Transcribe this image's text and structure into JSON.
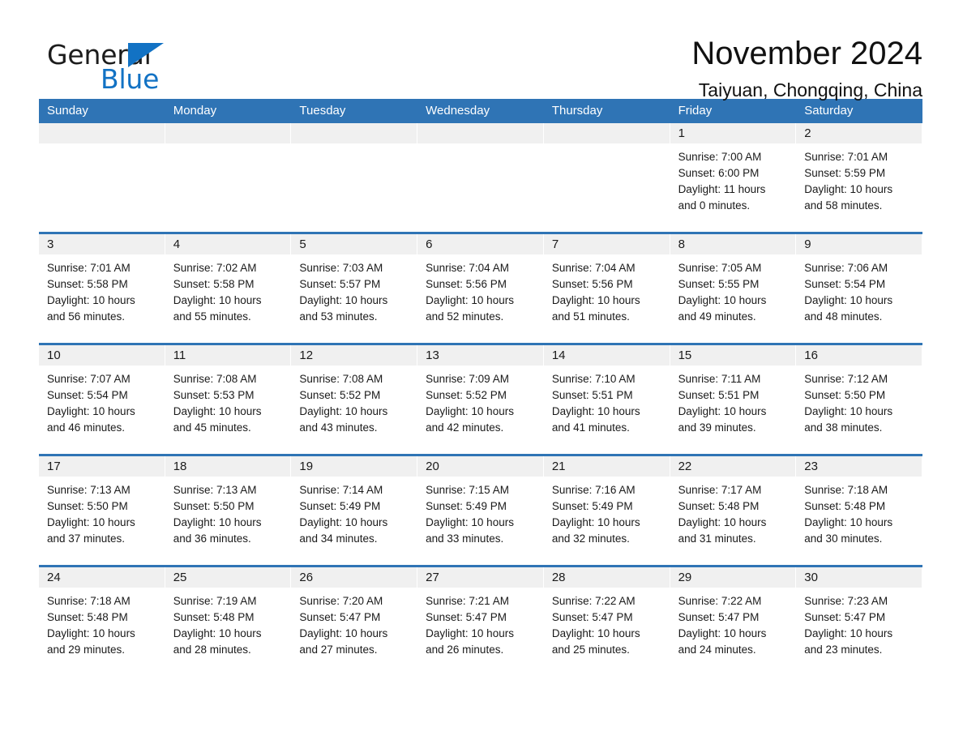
{
  "brand": {
    "word_general": "General",
    "word_blue": "Blue",
    "accent_color": "#1272c4"
  },
  "header": {
    "month_title": "November 2024",
    "location": "Taiyuan, Chongqing, China"
  },
  "calendar": {
    "header_color": "#2f74b5",
    "weekdays": [
      "Sunday",
      "Monday",
      "Tuesday",
      "Wednesday",
      "Thursday",
      "Friday",
      "Saturday"
    ],
    "weeks": [
      [
        {
          "day": "",
          "lines": []
        },
        {
          "day": "",
          "lines": []
        },
        {
          "day": "",
          "lines": []
        },
        {
          "day": "",
          "lines": []
        },
        {
          "day": "",
          "lines": []
        },
        {
          "day": "1",
          "lines": [
            "Sunrise: 7:00 AM",
            "Sunset: 6:00 PM",
            "Daylight: 11 hours",
            "and 0 minutes."
          ]
        },
        {
          "day": "2",
          "lines": [
            "Sunrise: 7:01 AM",
            "Sunset: 5:59 PM",
            "Daylight: 10 hours",
            "and 58 minutes."
          ]
        }
      ],
      [
        {
          "day": "3",
          "lines": [
            "Sunrise: 7:01 AM",
            "Sunset: 5:58 PM",
            "Daylight: 10 hours",
            "and 56 minutes."
          ]
        },
        {
          "day": "4",
          "lines": [
            "Sunrise: 7:02 AM",
            "Sunset: 5:58 PM",
            "Daylight: 10 hours",
            "and 55 minutes."
          ]
        },
        {
          "day": "5",
          "lines": [
            "Sunrise: 7:03 AM",
            "Sunset: 5:57 PM",
            "Daylight: 10 hours",
            "and 53 minutes."
          ]
        },
        {
          "day": "6",
          "lines": [
            "Sunrise: 7:04 AM",
            "Sunset: 5:56 PM",
            "Daylight: 10 hours",
            "and 52 minutes."
          ]
        },
        {
          "day": "7",
          "lines": [
            "Sunrise: 7:04 AM",
            "Sunset: 5:56 PM",
            "Daylight: 10 hours",
            "and 51 minutes."
          ]
        },
        {
          "day": "8",
          "lines": [
            "Sunrise: 7:05 AM",
            "Sunset: 5:55 PM",
            "Daylight: 10 hours",
            "and 49 minutes."
          ]
        },
        {
          "day": "9",
          "lines": [
            "Sunrise: 7:06 AM",
            "Sunset: 5:54 PM",
            "Daylight: 10 hours",
            "and 48 minutes."
          ]
        }
      ],
      [
        {
          "day": "10",
          "lines": [
            "Sunrise: 7:07 AM",
            "Sunset: 5:54 PM",
            "Daylight: 10 hours",
            "and 46 minutes."
          ]
        },
        {
          "day": "11",
          "lines": [
            "Sunrise: 7:08 AM",
            "Sunset: 5:53 PM",
            "Daylight: 10 hours",
            "and 45 minutes."
          ]
        },
        {
          "day": "12",
          "lines": [
            "Sunrise: 7:08 AM",
            "Sunset: 5:52 PM",
            "Daylight: 10 hours",
            "and 43 minutes."
          ]
        },
        {
          "day": "13",
          "lines": [
            "Sunrise: 7:09 AM",
            "Sunset: 5:52 PM",
            "Daylight: 10 hours",
            "and 42 minutes."
          ]
        },
        {
          "day": "14",
          "lines": [
            "Sunrise: 7:10 AM",
            "Sunset: 5:51 PM",
            "Daylight: 10 hours",
            "and 41 minutes."
          ]
        },
        {
          "day": "15",
          "lines": [
            "Sunrise: 7:11 AM",
            "Sunset: 5:51 PM",
            "Daylight: 10 hours",
            "and 39 minutes."
          ]
        },
        {
          "day": "16",
          "lines": [
            "Sunrise: 7:12 AM",
            "Sunset: 5:50 PM",
            "Daylight: 10 hours",
            "and 38 minutes."
          ]
        }
      ],
      [
        {
          "day": "17",
          "lines": [
            "Sunrise: 7:13 AM",
            "Sunset: 5:50 PM",
            "Daylight: 10 hours",
            "and 37 minutes."
          ]
        },
        {
          "day": "18",
          "lines": [
            "Sunrise: 7:13 AM",
            "Sunset: 5:50 PM",
            "Daylight: 10 hours",
            "and 36 minutes."
          ]
        },
        {
          "day": "19",
          "lines": [
            "Sunrise: 7:14 AM",
            "Sunset: 5:49 PM",
            "Daylight: 10 hours",
            "and 34 minutes."
          ]
        },
        {
          "day": "20",
          "lines": [
            "Sunrise: 7:15 AM",
            "Sunset: 5:49 PM",
            "Daylight: 10 hours",
            "and 33 minutes."
          ]
        },
        {
          "day": "21",
          "lines": [
            "Sunrise: 7:16 AM",
            "Sunset: 5:49 PM",
            "Daylight: 10 hours",
            "and 32 minutes."
          ]
        },
        {
          "day": "22",
          "lines": [
            "Sunrise: 7:17 AM",
            "Sunset: 5:48 PM",
            "Daylight: 10 hours",
            "and 31 minutes."
          ]
        },
        {
          "day": "23",
          "lines": [
            "Sunrise: 7:18 AM",
            "Sunset: 5:48 PM",
            "Daylight: 10 hours",
            "and 30 minutes."
          ]
        }
      ],
      [
        {
          "day": "24",
          "lines": [
            "Sunrise: 7:18 AM",
            "Sunset: 5:48 PM",
            "Daylight: 10 hours",
            "and 29 minutes."
          ]
        },
        {
          "day": "25",
          "lines": [
            "Sunrise: 7:19 AM",
            "Sunset: 5:48 PM",
            "Daylight: 10 hours",
            "and 28 minutes."
          ]
        },
        {
          "day": "26",
          "lines": [
            "Sunrise: 7:20 AM",
            "Sunset: 5:47 PM",
            "Daylight: 10 hours",
            "and 27 minutes."
          ]
        },
        {
          "day": "27",
          "lines": [
            "Sunrise: 7:21 AM",
            "Sunset: 5:47 PM",
            "Daylight: 10 hours",
            "and 26 minutes."
          ]
        },
        {
          "day": "28",
          "lines": [
            "Sunrise: 7:22 AM",
            "Sunset: 5:47 PM",
            "Daylight: 10 hours",
            "and 25 minutes."
          ]
        },
        {
          "day": "29",
          "lines": [
            "Sunrise: 7:22 AM",
            "Sunset: 5:47 PM",
            "Daylight: 10 hours",
            "and 24 minutes."
          ]
        },
        {
          "day": "30",
          "lines": [
            "Sunrise: 7:23 AM",
            "Sunset: 5:47 PM",
            "Daylight: 10 hours",
            "and 23 minutes."
          ]
        }
      ]
    ]
  }
}
